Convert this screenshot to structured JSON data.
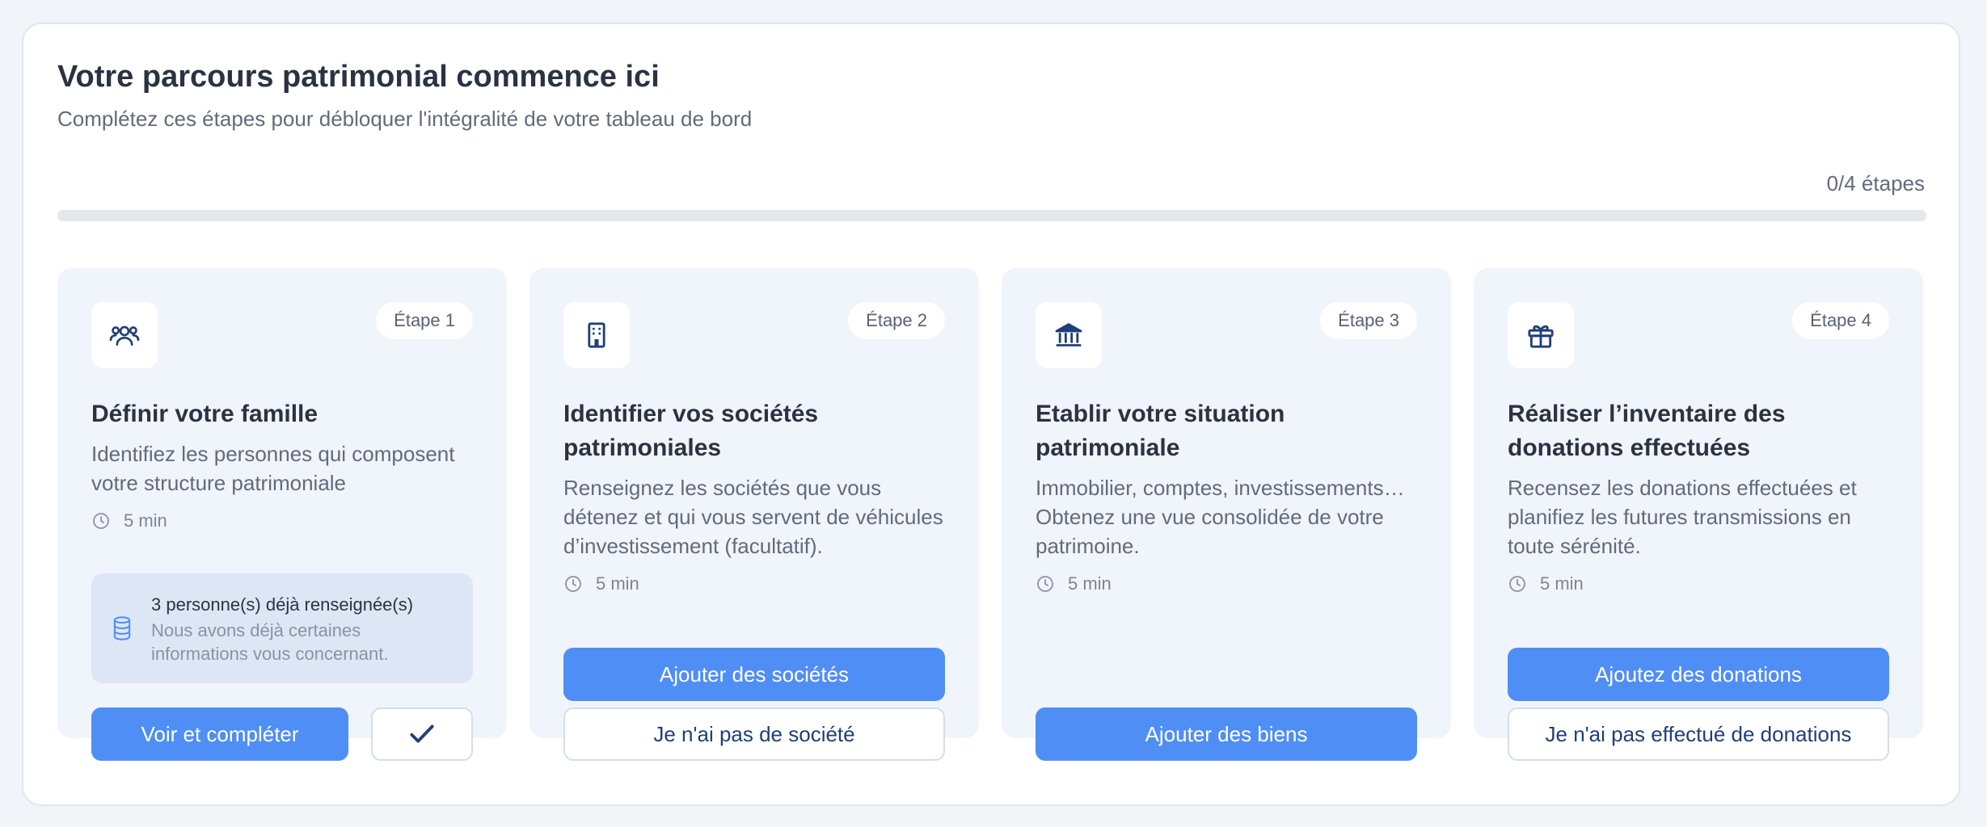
{
  "header": {
    "title": "Votre parcours patrimonial commence ici",
    "subtitle": "Complétez ces étapes pour débloquer l'intégralité de votre tableau de bord",
    "progress_label": "0/4 étapes",
    "progress_value": 0
  },
  "colors": {
    "accent": "#4f8ef5",
    "card_background": "#f0f4fb",
    "icon_color": "#1f3f7a"
  },
  "steps": [
    {
      "badge": "Étape 1",
      "icon": "family-icon",
      "title": "Définir votre famille",
      "description": "Identifiez les personnes qui composent votre structure patrimoniale",
      "duration": "5 min",
      "info": {
        "icon": "database-icon",
        "title": "3 personne(s) déjà renseignée(s)",
        "subtitle": "Nous avons déjà certaines informations vous concernant."
      },
      "primary_label": "Voir et compléter",
      "check_icon": "check-icon"
    },
    {
      "badge": "Étape 2",
      "icon": "building-icon",
      "title": "Identifier vos sociétés patrimoniales",
      "description": "Renseignez les sociétés que vous détenez et qui vous servent de véhicules d’investissement (facultatif).",
      "duration": "5 min",
      "primary_label": "Ajouter des sociétés",
      "secondary_label": "Je n'ai pas de société"
    },
    {
      "badge": "Étape 3",
      "icon": "bank-icon",
      "title": "Etablir votre situation patrimoniale",
      "description": "Immobilier, comptes, investissements… Obtenez une vue consolidée de votre patrimoine.",
      "duration": "5 min",
      "primary_label": "Ajouter des biens"
    },
    {
      "badge": "Étape 4",
      "icon": "gift-icon",
      "title": "Réaliser l’inventaire des donations effectuées",
      "description": "Recensez les donations effectuées et planifiez les futures transmissions en toute sérénité.",
      "duration": "5 min",
      "primary_label": "Ajoutez des donations",
      "secondary_label": "Je n'ai pas effectué de donations"
    }
  ]
}
